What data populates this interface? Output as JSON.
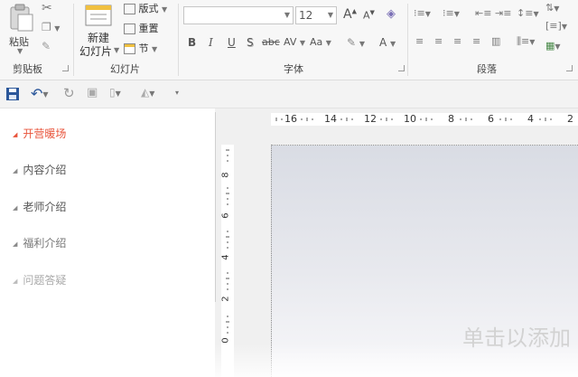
{
  "ribbon": {
    "clipboard": {
      "paste_label": "粘贴",
      "group_label": "剪贴板"
    },
    "slides": {
      "new_slide_line1": "新建",
      "new_slide_line2": "幻灯片",
      "layout_label": "版式",
      "reset_label": "重置",
      "section_label": "节",
      "group_label": "幻灯片"
    },
    "font": {
      "font_name_value": "",
      "font_size_value": "12",
      "group_label": "字体",
      "bold": "B",
      "italic": "I",
      "underline": "U",
      "shadow": "S",
      "strikethrough": "abc",
      "spacing": "AV",
      "change_case": "Aa",
      "font_color": "A",
      "grow": "A",
      "shrink": "A"
    },
    "paragraph": {
      "group_label": "段落"
    }
  },
  "outline": {
    "items": [
      {
        "label": "开营暖场",
        "color": "#e8533a"
      },
      {
        "label": "内容介绍",
        "color": "#555555"
      },
      {
        "label": "老师介绍",
        "color": "#555555"
      },
      {
        "label": "福利介绍",
        "color": "#777777"
      },
      {
        "label": "问题答疑",
        "color": "#aaaaaa"
      }
    ]
  },
  "ruler": {
    "horizontal_labels": [
      "16",
      "14",
      "12",
      "10",
      "8",
      "6",
      "4",
      "2"
    ],
    "vertical_labels": [
      "8",
      "6",
      "4",
      "2",
      "0"
    ]
  },
  "slide": {
    "placeholder_text": "单击以添加"
  },
  "colors": {
    "accent_outline": "#e8533a",
    "ribbon_bg": "#f7f7f7",
    "save_icon": "#2b579a",
    "undo_icon": "#2b579a"
  }
}
